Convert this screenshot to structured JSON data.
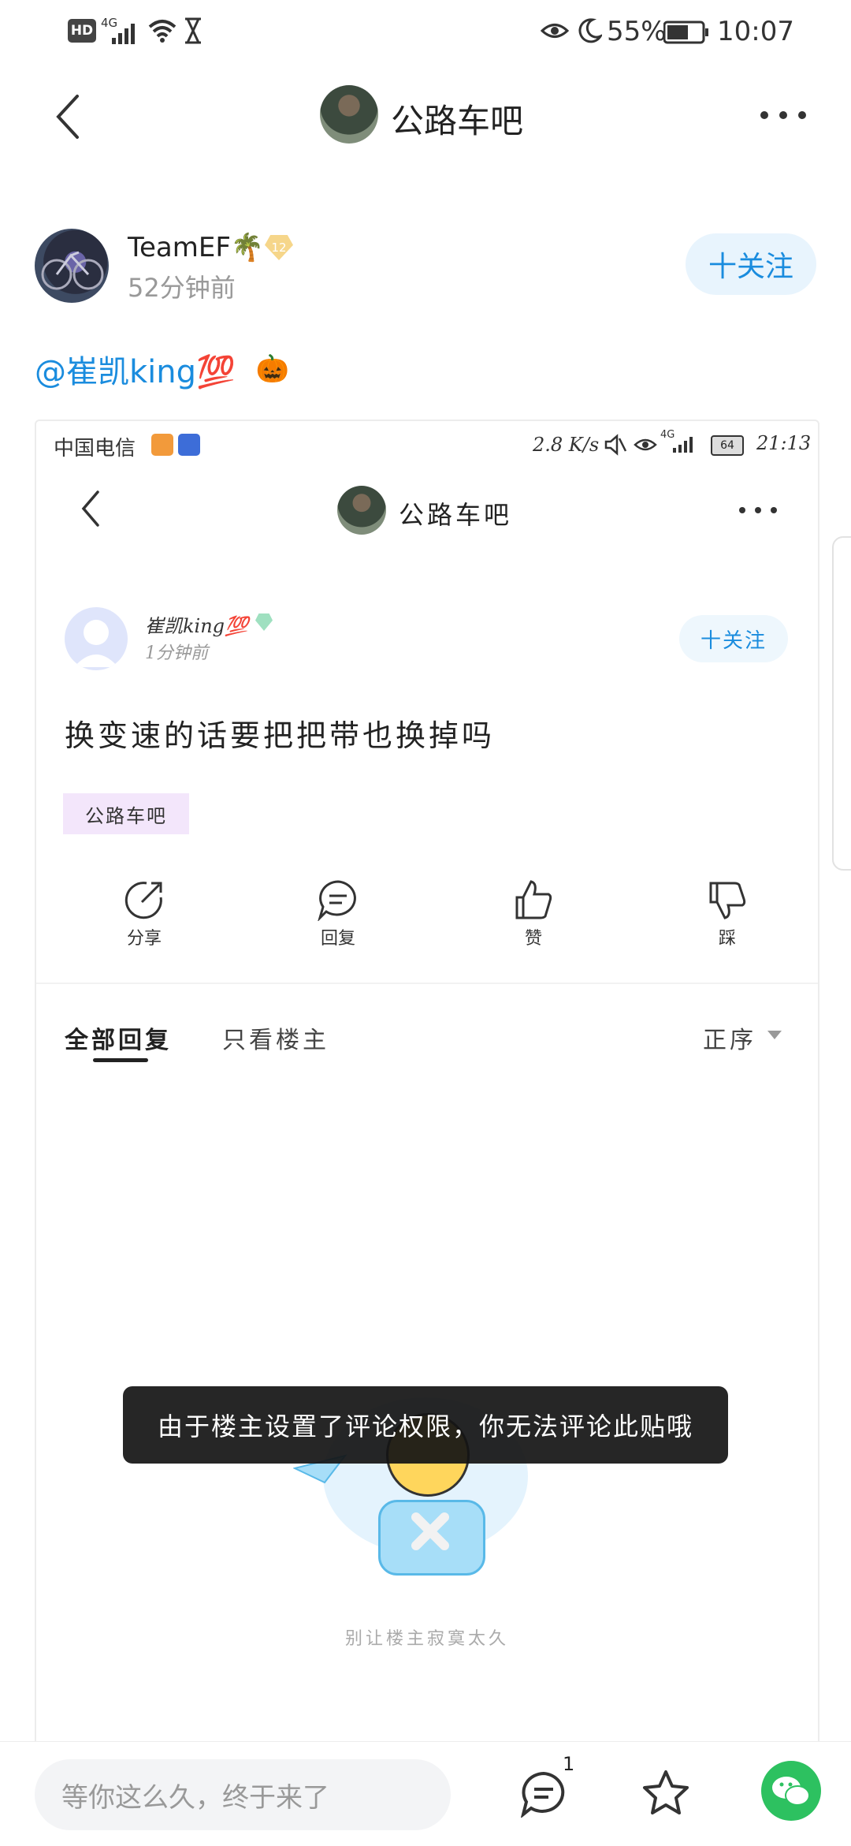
{
  "status_bar": {
    "left_badge": "HD",
    "network": "4G",
    "battery_pct": "55%",
    "time": "10:07"
  },
  "header": {
    "title": "公路车吧"
  },
  "post": {
    "author": "TeamEF🌴",
    "level_badge": "12",
    "time_ago": "52分钟前",
    "follow_label": "十关注",
    "text": "@崔凯king💯",
    "text_emoji": "🎃"
  },
  "inner": {
    "status_bar": {
      "carrier": "中国电信",
      "speed": "2.8 K/s",
      "network": "4G",
      "battery": "64",
      "time": "21:13"
    },
    "header_title": "公路车吧",
    "author": "崔凯king💯",
    "time_ago": "1分钟前",
    "follow_label": "十关注",
    "post_text": "换变速的话要把把带也换掉吗",
    "tag": "公路车吧",
    "actions": [
      {
        "label": "分享",
        "icon": "share-icon"
      },
      {
        "label": "回复",
        "icon": "reply-icon"
      },
      {
        "label": "赞",
        "icon": "thumbs-up-icon"
      },
      {
        "label": "踩",
        "icon": "thumbs-down-icon"
      }
    ],
    "tabs": {
      "all": "全部回复",
      "op_only": "只看楼主",
      "sort": "正序"
    },
    "toast": "由于楼主设置了评论权限，你无法评论此贴哦",
    "empty_caption": "别让楼主寂寞太久"
  },
  "bottom_bar": {
    "input_placeholder": "等你这么久，终于来了",
    "comment_count": "1"
  },
  "colors": {
    "accent": "#1a8cde",
    "follow_bg": "#e8f4fd",
    "wechat": "#2dc160",
    "tag_bg": "#f3e6fb"
  }
}
